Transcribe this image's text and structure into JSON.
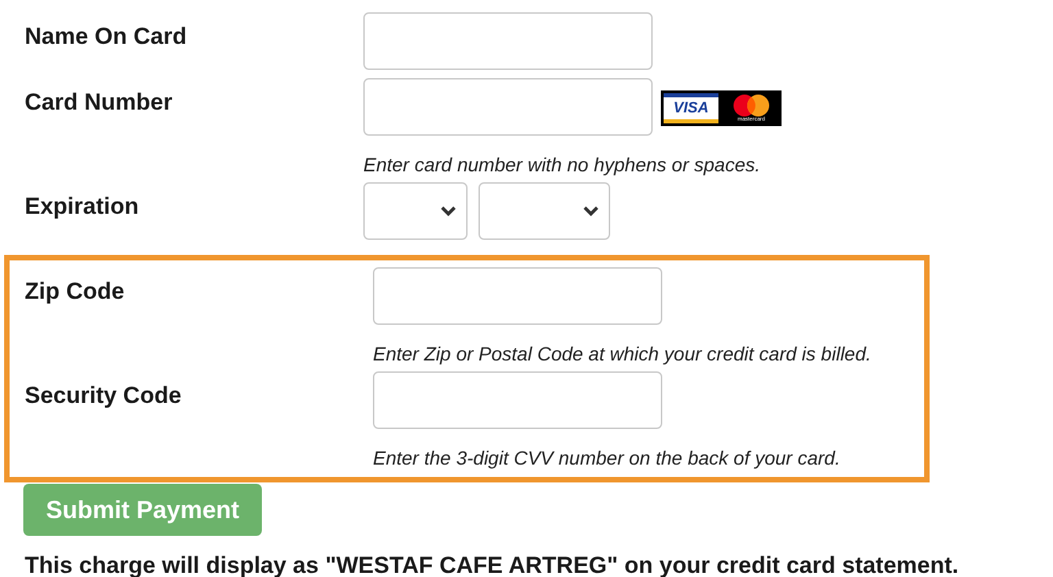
{
  "fields": [
    {
      "kind": "text",
      "label": "Name On Card"
    },
    {
      "kind": "card",
      "label": "Card Number",
      "logos": [
        "VISA",
        "mastercard"
      ],
      "hint": "Enter card number with no hyphens or spaces."
    },
    {
      "kind": "select_pair",
      "label": "Expiration"
    }
  ],
  "highlighted_fields": [
    {
      "kind": "text",
      "label": "Zip Code",
      "hint": "Enter Zip or Postal Code at which your credit card is billed."
    },
    {
      "kind": "text",
      "label": "Security Code",
      "hint": "Enter the 3-digit CVV number on the back of your card."
    }
  ],
  "submit_button": "Submit Payment",
  "footer": "This charge will display as \"WESTAF CAFE ARTREG\" on your credit card statement."
}
